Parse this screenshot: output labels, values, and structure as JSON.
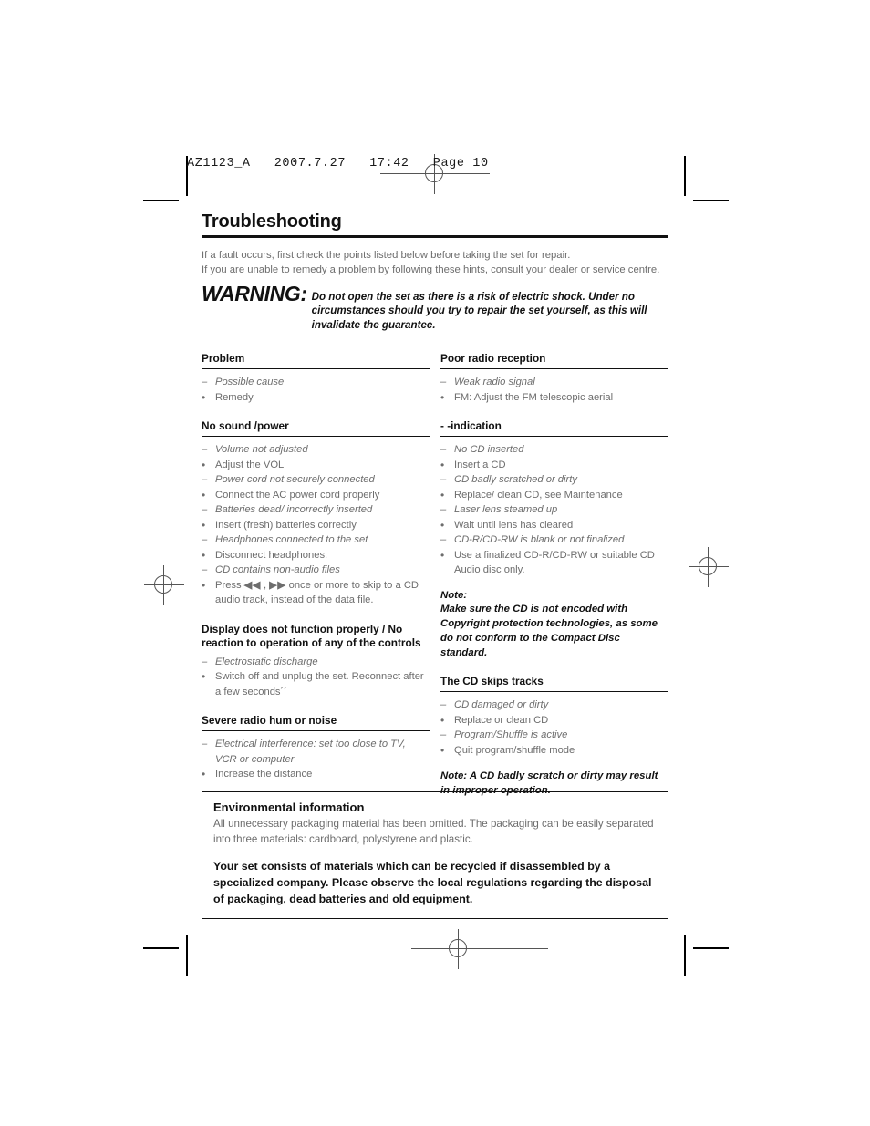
{
  "page_header": "AZ1123_A   2007.7.27   17:42   Page 10",
  "document": {
    "title": "Troubleshooting",
    "intro_line1": "If a fault occurs, first check the points listed below before taking the set for repair.",
    "intro_line2": "If you are unable to remedy a problem by following these hints, consult your dealer or service centre.",
    "warning_label": "WARNING:",
    "warning_text": "Do not open the set as there is a risk of electric shock. Under no circumstances should you try to repair the set yourself, as this will invalidate the guarantee."
  },
  "left_column": {
    "sections": [
      {
        "heading": "Problem",
        "items": [
          {
            "type": "cause",
            "text": "Possible cause"
          },
          {
            "type": "remedy",
            "text": "Remedy"
          }
        ]
      },
      {
        "heading": "No sound /power",
        "items": [
          {
            "type": "cause",
            "text": "Volume not adjusted"
          },
          {
            "type": "remedy",
            "text": "Adjust the VOL"
          },
          {
            "type": "cause",
            "text": "Power cord not securely connected"
          },
          {
            "type": "remedy",
            "text": "Connect the AC power cord properly"
          },
          {
            "type": "cause",
            "text": "Batteries dead/ incorrectly inserted"
          },
          {
            "type": "remedy",
            "text": "Insert (fresh) batteries correctly"
          },
          {
            "type": "cause",
            "text": "Headphones connected to the set"
          },
          {
            "type": "remedy",
            "text": "Disconnect headphones."
          },
          {
            "type": "cause",
            "text": "CD contains non-audio files"
          },
          {
            "type": "remedy_glyph",
            "pre": "Press ",
            "glyph1": "◀◀",
            "mid": " , ",
            "glyph2": "▶▶",
            "post": " once or more to skip to a CD audio track, instead of the data file."
          }
        ]
      },
      {
        "heading": "Display does not function properly / No reaction to operation of any of the controls",
        "no_rule": true,
        "items": [
          {
            "type": "cause",
            "text": "Electrostatic discharge"
          },
          {
            "type": "remedy",
            "text": "Switch off and unplug the set. Reconnect after a few seconds´´"
          }
        ]
      },
      {
        "heading": "Severe radio hum or noise",
        "items": [
          {
            "type": "cause",
            "text": "Electrical interference: set too close to TV, VCR or computer"
          },
          {
            "type": "remedy",
            "text": "Increase the distance"
          }
        ]
      }
    ]
  },
  "right_column": {
    "sections": [
      {
        "heading": "Poor radio reception",
        "items": [
          {
            "type": "cause",
            "text": "Weak radio signal"
          },
          {
            "type": "remedy",
            "text": "FM: Adjust the FM telescopic aerial"
          }
        ]
      },
      {
        "heading": "- -indication",
        "items": [
          {
            "type": "cause",
            "text": "No CD inserted"
          },
          {
            "type": "remedy",
            "text": "Insert a CD"
          },
          {
            "type": "cause",
            "text": "CD badly scratched or dirty"
          },
          {
            "type": "remedy",
            "text": "Replace/ clean CD, see Maintenance"
          },
          {
            "type": "cause",
            "text": "Laser lens steamed up"
          },
          {
            "type": "remedy",
            "text": "Wait until lens has cleared"
          },
          {
            "type": "cause",
            "text": "CD-R/CD-RW is blank or not finalized"
          },
          {
            "type": "remedy",
            "text": "Use a finalized CD-R/CD-RW or suitable CD Audio disc only."
          }
        ],
        "note": "Note:\nMake sure the CD is not encoded with Copyright protection technologies, as some do not conform to the Compact Disc standard."
      },
      {
        "heading": "The CD skips tracks",
        "items": [
          {
            "type": "cause",
            "text": "CD damaged or dirty"
          },
          {
            "type": "remedy",
            "text": "Replace or clean CD"
          },
          {
            "type": "cause",
            "text": "Program/Shuffle is active"
          },
          {
            "type": "remedy",
            "text": "Quit program/shuffle mode"
          }
        ],
        "note_inline": "Note: A CD badly scratch or dirty may result in improper operation."
      }
    ]
  },
  "environmental": {
    "title": "Environmental information",
    "body": "All unnecessary packaging material has been omitted. The packaging can be easily separated into three materials: cardboard, polystyrene and plastic.",
    "bold": "Your set consists of materials which can be recycled if disassembled by a specialized company. Please observe the local regulations regarding the disposal of packaging, dead batteries and old equipment."
  },
  "markers": {
    "cause_marker": "–",
    "remedy_marker": "•"
  }
}
